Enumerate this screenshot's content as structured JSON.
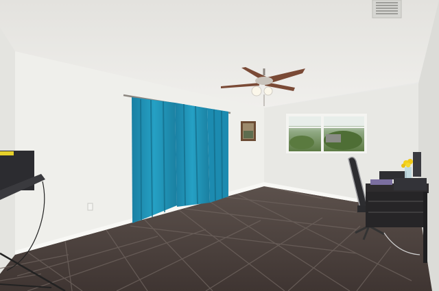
{
  "scene": {
    "description_items": [
      "textured-ceiling",
      "ceiling-fan-with-light",
      "air-vent",
      "teal-curtains",
      "framed-picture",
      "window",
      "office-chair",
      "desk-with-printer",
      "yellow-flowers",
      "monitor",
      "tile-floor"
    ]
  },
  "colors": {
    "ceiling": "#e8e7e3",
    "wall_left": "#efefeb",
    "wall_back": "#e7e7e3",
    "wall_right": "#e2e2de",
    "floor": "#4f4440",
    "grout": "#6a605b",
    "curtain": "#1f8fb3",
    "curtain_dark": "#17708e",
    "baseboard": "#f6f6f3",
    "desk": "#2a2a2c",
    "flowers": "#f3d21a"
  }
}
